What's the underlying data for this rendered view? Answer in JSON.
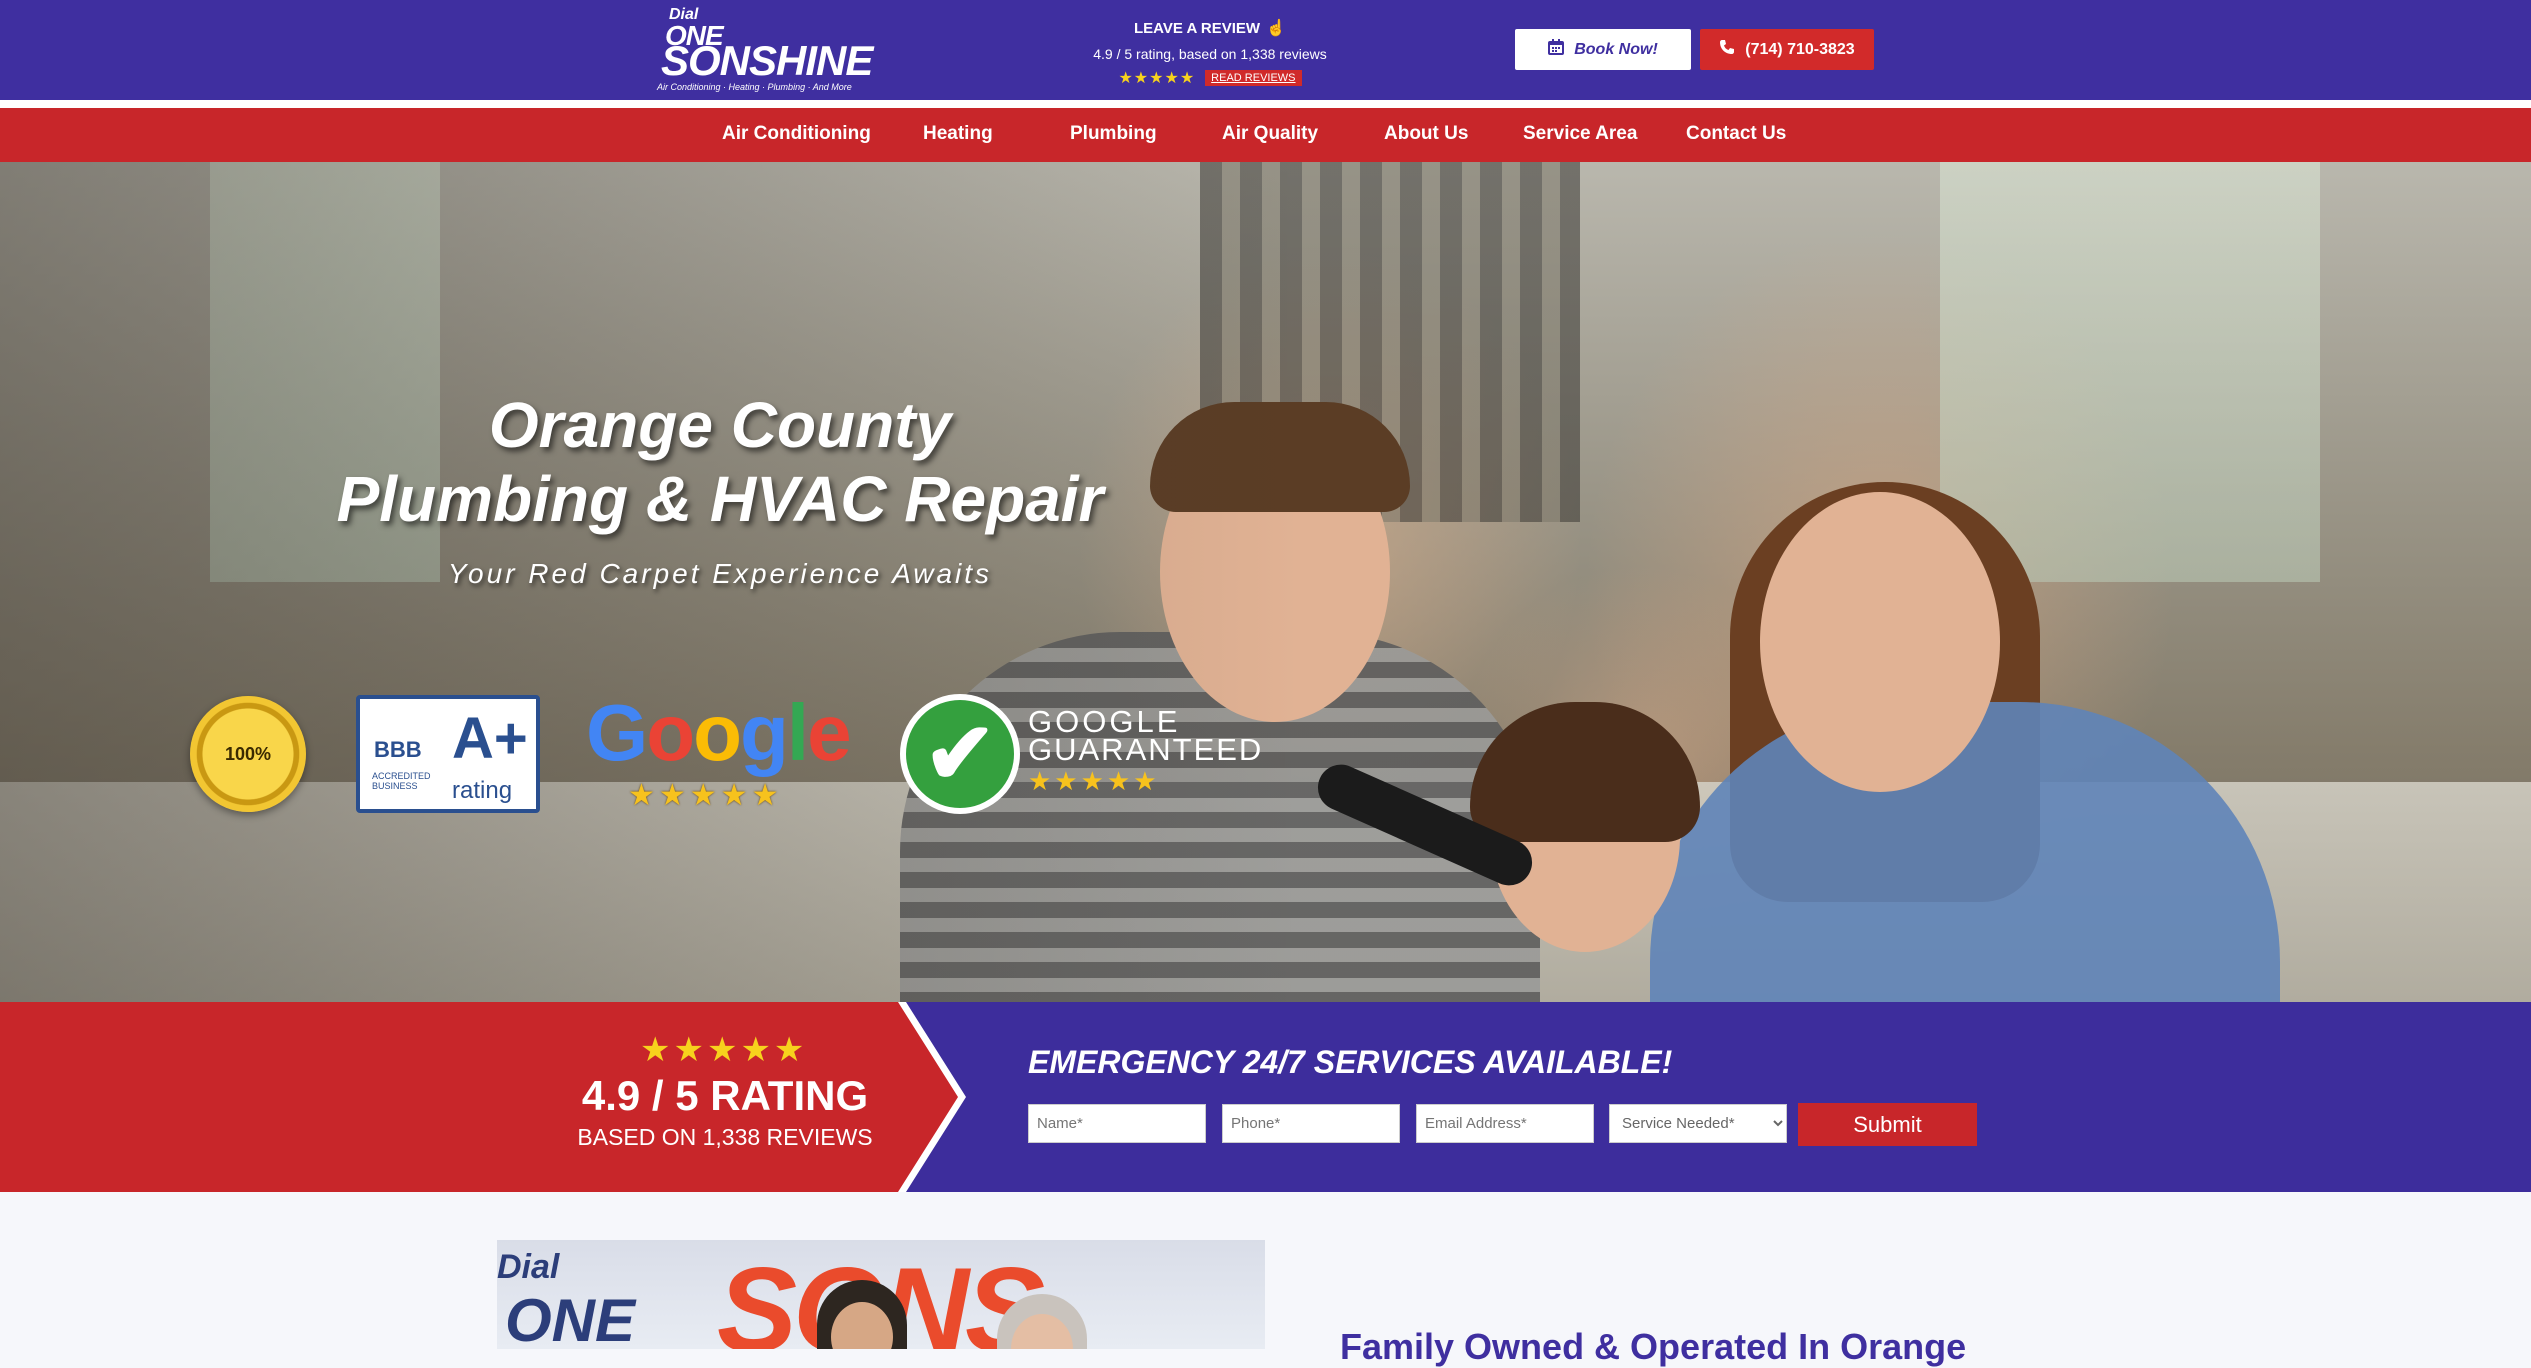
{
  "header": {
    "logo": {
      "dial": "Dial",
      "one": "ONE",
      "name": "SONSHINE",
      "tagline": "Air Conditioning · Heating · Plumbing · And More"
    },
    "review": {
      "leave_label": "LEAVE A REVIEW",
      "rating_text": "4.9 / 5 rating, based on 1,338 reviews",
      "stars": "★★★★★",
      "read_label": "READ REVIEWS"
    },
    "book_label": "Book Now!",
    "phone_label": "(714) 710-3823"
  },
  "nav": {
    "items": [
      {
        "label": "Air Conditioning"
      },
      {
        "label": "Heating"
      },
      {
        "label": "Plumbing"
      },
      {
        "label": "Air Quality"
      },
      {
        "label": "About Us"
      },
      {
        "label": "Service Area"
      },
      {
        "label": "Contact Us"
      }
    ]
  },
  "hero": {
    "title_line1": "Orange County",
    "title_line2": "Plumbing & HVAC Repair",
    "subtitle": "Your Red Carpet Experience Awaits",
    "badges": {
      "satisfaction": "100%",
      "bbb_label": "BBB",
      "bbb_accredited": "ACCREDITED BUSINESS",
      "bbb_grade": "A+",
      "bbb_rating": "rating",
      "google_word": "Google",
      "google_stars": "★★★★★",
      "guaranteed_line1": "GOOGLE",
      "guaranteed_line2": "GUARANTEED",
      "guaranteed_stars": "★★★★★"
    }
  },
  "cta": {
    "stars": "★★★★★",
    "rating": "4.9 / 5 RATING",
    "based_on": "BASED ON 1,338 REVIEWS",
    "emergency": "EMERGENCY 24/7 SERVICES AVAILABLE!",
    "form": {
      "name_placeholder": "Name*",
      "phone_placeholder": "Phone*",
      "email_placeholder": "Email Address*",
      "service_selected": "Service Needed*",
      "submit_label": "Submit"
    }
  },
  "lower": {
    "promo_dial": "Dial",
    "promo_one": "ONE",
    "promo_sons": "SONS",
    "heading": "Family Owned & Operated In Orange"
  },
  "colors": {
    "brand_purple": "#3f2fa0",
    "brand_red": "#c8262a",
    "star_yellow": "#f7d21d"
  }
}
